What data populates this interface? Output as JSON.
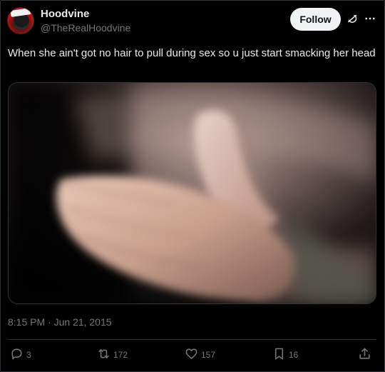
{
  "author": {
    "name": "Hoodvine",
    "handle": "@TheRealHoodvine"
  },
  "header": {
    "follow_label": "Follow"
  },
  "tweet": {
    "text": "When she ain't got no hair to pull during sex so u just start smacking her head",
    "timestamp": "8:15 PM · Jun 21, 2015"
  },
  "actions": {
    "replies": "3",
    "reposts": "172",
    "likes": "157",
    "bookmarks": "16"
  },
  "colors": {
    "background": "#000000",
    "primary_text": "#e7e9ea",
    "secondary_text": "#71767b",
    "follow_button_bg": "#eff3f4",
    "divider": "#2f3336"
  },
  "icons": {
    "grok": "grok-icon",
    "more": "more-icon",
    "reply": "reply-icon",
    "repost": "repost-icon",
    "like": "heart-icon",
    "bookmark": "bookmark-icon",
    "share": "share-icon"
  }
}
